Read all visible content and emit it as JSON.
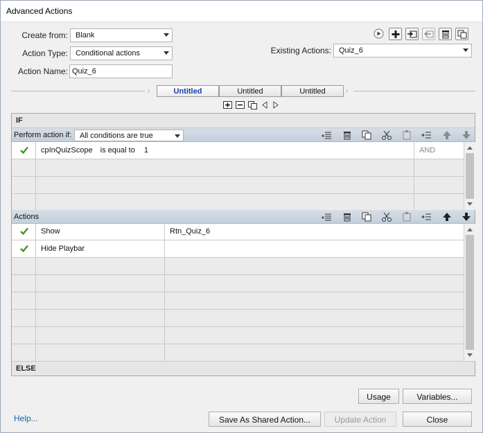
{
  "window": {
    "title": "Advanced Actions"
  },
  "form": {
    "create_from_label": "Create from:",
    "create_from_value": "Blank",
    "action_type_label": "Action Type:",
    "action_type_value": "Conditional actions",
    "action_name_label": "Action Name:",
    "action_name_value": "Quiz_6",
    "existing_label": "Existing Actions:",
    "existing_value": "Quiz_6"
  },
  "toolbar_icons": [
    "preview-icon",
    "add-icon",
    "import-icon",
    "export-icon",
    "delete-icon",
    "duplicate-icon"
  ],
  "tabs": [
    {
      "label": "Untitled",
      "active": true
    },
    {
      "label": "Untitled",
      "active": false
    },
    {
      "label": "Untitled",
      "active": false
    }
  ],
  "if_section": {
    "header": "IF",
    "perform_label": "Perform action if:",
    "condition_mode": "All conditions are true",
    "rows": [
      {
        "variable": "cpInQuizScope",
        "operator": "is equal to",
        "value": "1",
        "logic": "AND",
        "checked": true
      }
    ]
  },
  "actions_section": {
    "header": "Actions",
    "rows": [
      {
        "action": "Show",
        "target": "Rtn_Quiz_6",
        "checked": true
      },
      {
        "action": "Hide Playbar",
        "target": "",
        "checked": true
      }
    ]
  },
  "else_section": {
    "header": "ELSE"
  },
  "buttons": {
    "usage": "Usage",
    "variables": "Variables...",
    "help": "Help...",
    "save_shared": "Save As Shared Action...",
    "update": "Update Action",
    "close": "Close"
  }
}
